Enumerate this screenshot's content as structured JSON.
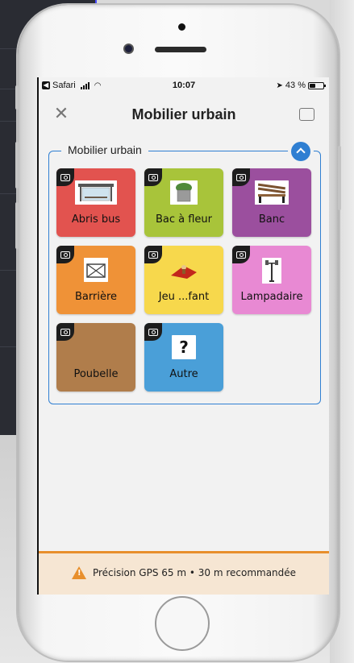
{
  "status_bar": {
    "app": "Safari",
    "time": "10:07",
    "battery": "43 %",
    "battery_level": 0.43
  },
  "nav": {
    "title": "Mobilier urbain",
    "close_icon": "close-icon",
    "expand_icon": "expand-icon"
  },
  "group": {
    "legend": "Mobilier urbain",
    "collapse_icon": "chevron-up-icon",
    "tiles": [
      {
        "label": "Abris bus",
        "color": "#e2534f",
        "image": "bus-shelter"
      },
      {
        "label": "Bac à fleur",
        "color": "#a8c43a",
        "image": "flower-planter"
      },
      {
        "label": "Banc",
        "color": "#9b4f9e",
        "image": "bench"
      },
      {
        "label": "Barrière",
        "color": "#ef9237",
        "image": "barrier"
      },
      {
        "label": "Jeu ...fant",
        "color": "#f7d84c",
        "image": "playground"
      },
      {
        "label": "Lampadaire",
        "color": "#e889d3",
        "image": "street-lamp"
      },
      {
        "label": "Poubelle",
        "color": "#b07d4b",
        "image": "trash-bin"
      },
      {
        "label": "Autre",
        "color": "#4a9fd8",
        "image": "question-mark",
        "glyph": "?"
      }
    ]
  },
  "gps_warning": {
    "text": "Précision GPS 65 m • 30 m recommandée",
    "color": "#e88f2c"
  }
}
